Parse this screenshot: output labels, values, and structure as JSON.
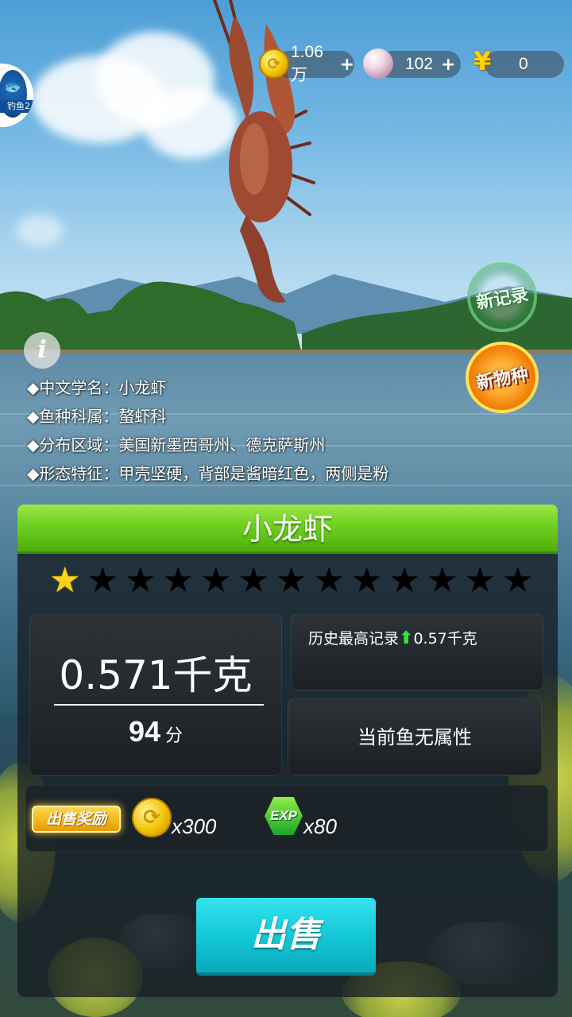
{
  "topbar": {
    "logo_text": "钓鱼2",
    "coins": {
      "value": "1.06万",
      "add": "+",
      "icon": "coin-icon"
    },
    "pearls": {
      "value": "102",
      "add": "+",
      "icon": "pearl-icon"
    },
    "cash": {
      "symbol": "¥",
      "value": "0",
      "icon": "yen-icon"
    }
  },
  "badges": {
    "new_record": "新记录",
    "new_species": "新物种"
  },
  "info": {
    "icon": "i",
    "lines": [
      "◆中文学名：小龙虾",
      "◆鱼种科属：螯虾科",
      "◆分布区域：美国新墨西哥州、德克萨斯州",
      "◆形态特征：甲壳坚硬，背部是酱暗红色，两侧是粉"
    ]
  },
  "result": {
    "fish_name": "小龙虾",
    "rating": {
      "filled": 1,
      "total": 13
    },
    "weight": "0.571千克",
    "score": "94",
    "score_unit": "分",
    "history_label": "历史最高记录",
    "history_value": "0.57千克",
    "attribute": "当前鱼无属性",
    "reward_label": "出售奖励",
    "reward_coins": "x300",
    "reward_exp_icon_text": "EXP",
    "reward_exp": "x80",
    "sell_button": "出售"
  },
  "colors": {
    "title_green": "#6fcf1e",
    "sell_cyan": "#12c6d6",
    "star_gold": "#ffd21a",
    "record_arrow": "#39e13a"
  }
}
